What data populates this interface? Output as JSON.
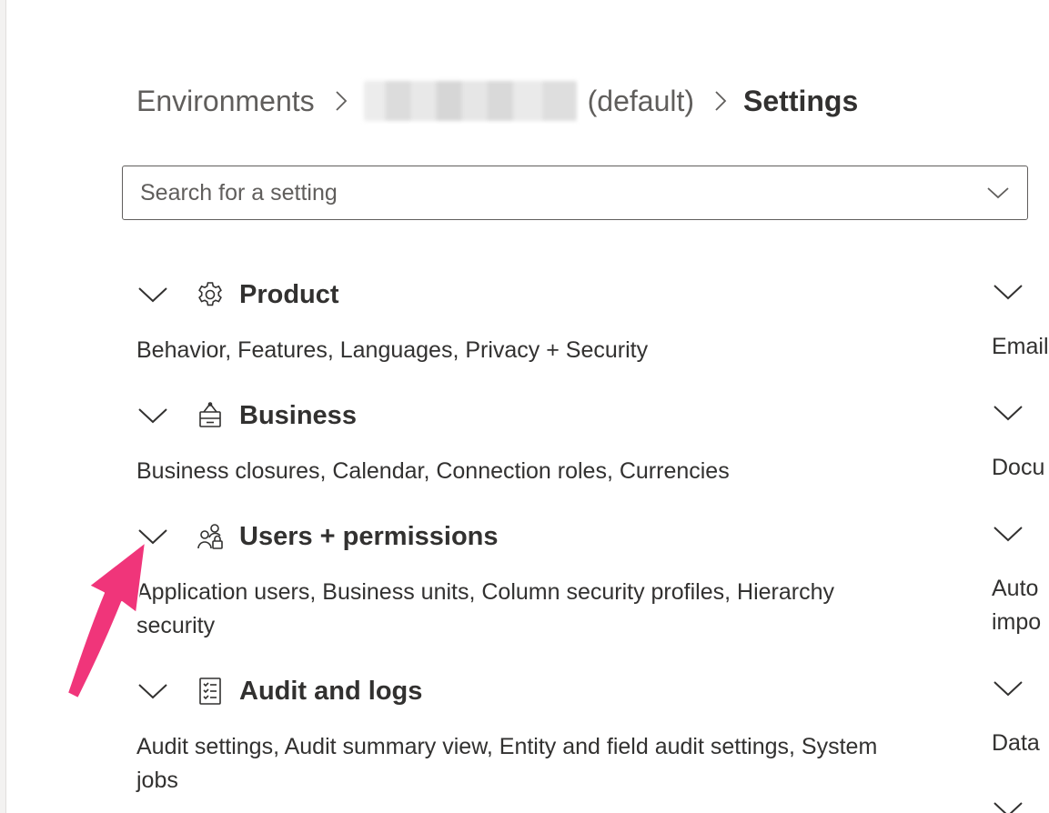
{
  "breadcrumb": {
    "environments": "Environments",
    "environment_suffix": "(default)",
    "current": "Settings"
  },
  "search": {
    "placeholder": "Search for a setting"
  },
  "groups": [
    {
      "title": "Product",
      "icon": "gear-icon",
      "links": "Behavior, Features, Languages, Privacy + Security"
    },
    {
      "title": "Business",
      "icon": "business-icon",
      "links": "Business closures, Calendar, Connection roles, Currencies"
    },
    {
      "title": "Users + permissions",
      "icon": "users-lock-icon",
      "links": "Application users, Business units, Column security profiles, Hierarchy security"
    },
    {
      "title": "Audit and logs",
      "icon": "checklist-icon",
      "links": "Audit settings, Audit summary view, Entity and field audit settings, System jobs"
    }
  ],
  "right_column": [
    {
      "text": "Email"
    },
    {
      "text": "Docu"
    },
    {
      "text": "Auto",
      "text2": "impo"
    },
    {
      "text": "Data"
    }
  ],
  "colors": {
    "text": "#323130",
    "muted": "#605e5c",
    "annotation": "#f0357a"
  }
}
